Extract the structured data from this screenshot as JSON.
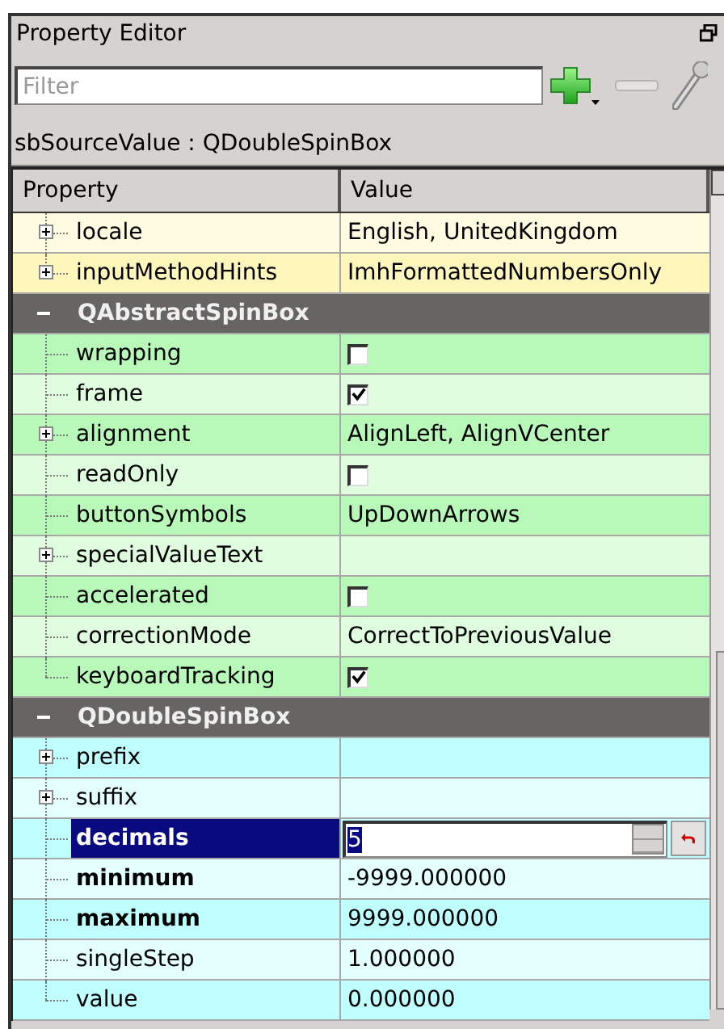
{
  "window": {
    "title": "Property Editor"
  },
  "filter": {
    "placeholder": "Filter"
  },
  "object_label": "sbSourceValue : QDoubleSpinBox",
  "columns": [
    "Property",
    "Value"
  ],
  "sections": [
    {
      "color": "#fff6bc",
      "rows": [
        {
          "name": "locale",
          "kind": "text",
          "value": "English, UnitedKingdom",
          "expandable": true,
          "modified": false,
          "selected": false
        },
        {
          "name": "inputMethodHints",
          "kind": "text",
          "value": "ImhFormattedNumbersOnly",
          "expandable": true,
          "modified": false,
          "selected": false
        }
      ]
    },
    {
      "title": "QAbstractSpinBox",
      "expanded": true,
      "color": "#b8f8b8",
      "rows": [
        {
          "name": "wrapping",
          "kind": "checkbox",
          "checked": false,
          "expandable": false,
          "modified": false,
          "selected": false
        },
        {
          "name": "frame",
          "kind": "checkbox",
          "checked": true,
          "expandable": false,
          "modified": false,
          "selected": false
        },
        {
          "name": "alignment",
          "kind": "text",
          "value": "AlignLeft, AlignVCenter",
          "expandable": true,
          "modified": false,
          "selected": false
        },
        {
          "name": "readOnly",
          "kind": "checkbox",
          "checked": false,
          "expandable": false,
          "modified": false,
          "selected": false
        },
        {
          "name": "buttonSymbols",
          "kind": "text",
          "value": "UpDownArrows",
          "expandable": false,
          "modified": false,
          "selected": false
        },
        {
          "name": "specialValueText",
          "kind": "text",
          "expandable": true,
          "modified": false,
          "selected": false
        },
        {
          "name": "accelerated",
          "kind": "checkbox",
          "checked": false,
          "expandable": false,
          "modified": false,
          "selected": false
        },
        {
          "name": "correctionMode",
          "kind": "text",
          "value": "CorrectToPreviousValue",
          "expandable": false,
          "modified": false,
          "selected": false
        },
        {
          "name": "keyboardTracking",
          "kind": "checkbox",
          "checked": true,
          "expandable": false,
          "modified": false,
          "selected": false
        }
      ]
    },
    {
      "title": "QDoubleSpinBox",
      "expanded": true,
      "color": "#c0ffff",
      "rows": [
        {
          "name": "prefix",
          "kind": "text",
          "expandable": true,
          "modified": false,
          "selected": false
        },
        {
          "name": "suffix",
          "kind": "text",
          "expandable": true,
          "modified": false,
          "selected": false
        },
        {
          "name": "decimals",
          "kind": "spin",
          "value": "5",
          "expandable": false,
          "modified": true,
          "selected": true
        },
        {
          "name": "minimum",
          "kind": "text",
          "value": "-9999.000000",
          "expandable": false,
          "modified": true,
          "selected": false
        },
        {
          "name": "maximum",
          "kind": "text",
          "value": "9999.000000",
          "expandable": false,
          "modified": true,
          "selected": false
        },
        {
          "name": "singleStep",
          "kind": "text",
          "value": "1.000000",
          "expandable": false,
          "modified": false,
          "selected": false
        },
        {
          "name": "value",
          "kind": "text",
          "value": "0.000000",
          "expandable": false,
          "modified": false,
          "selected": false
        }
      ]
    }
  ]
}
